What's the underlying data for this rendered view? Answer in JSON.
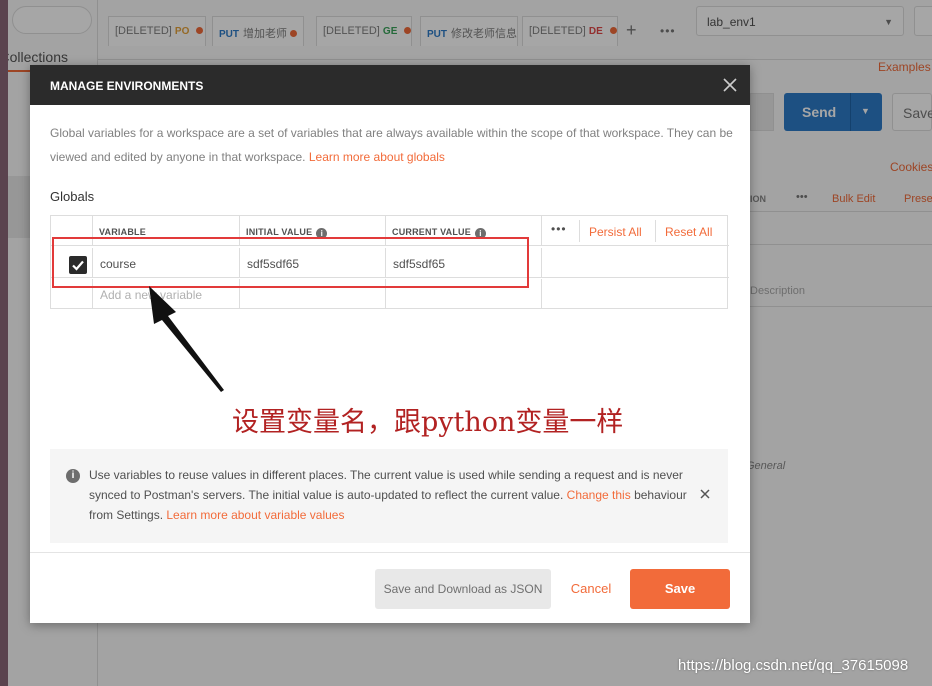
{
  "background": {
    "sidebar_tab": "Collections",
    "tabs": [
      {
        "method": "",
        "label": "[DELETED]",
        "suffix": "PO"
      },
      {
        "method": "PUT",
        "label": "增加老师",
        "suffix": ""
      },
      {
        "method": "",
        "label": "[DELETED]",
        "suffix": "GE"
      },
      {
        "method": "PUT",
        "label": "修改老师信息",
        "suffix": ""
      },
      {
        "method": "",
        "label": "[DELETED]",
        "suffix": "DE"
      }
    ],
    "env_name": "lab_env1",
    "examples_link": "Examples",
    "send_label": "Send",
    "save_label": "Save",
    "cookies_link": "Cookies",
    "params_header_suffix": "ION",
    "bulk_edit": "Bulk Edit",
    "presets": "Presets",
    "description_placeholder": "Description",
    "general_text": "General"
  },
  "modal": {
    "title": "MANAGE ENVIRONMENTS",
    "intro_text": "Global variables for a workspace are a set of variables that are always available within the scope of that workspace. They can be viewed and edited by anyone in that workspace.",
    "intro_link": "Learn more about globals",
    "section_title": "Globals",
    "table": {
      "col_variable": "VARIABLE",
      "col_initial": "INITIAL VALUE",
      "col_current": "CURRENT VALUE",
      "more": "•••",
      "persist_all": "Persist All",
      "reset_all": "Reset All",
      "rows": [
        {
          "checked": true,
          "variable": "course",
          "initial": "sdf5sdf65",
          "current": "sdf5sdf65"
        }
      ],
      "add_placeholder": "Add a new variable"
    },
    "notice": {
      "text": "Use variables to reuse values in different places. The current value is used while sending a request and is never synced to Postman's servers. The initial value is auto-updated to reflect the current value.",
      "link_change": "Change this",
      "text_after": "behaviour from Settings.",
      "link_learn": "Learn more about variable values"
    },
    "buttons": {
      "save_download": "Save and Download as JSON",
      "cancel": "Cancel",
      "save": "Save"
    }
  },
  "annotation": {
    "text": "设置变量名，跟python变量一样",
    "color": "#b22222",
    "box_color": "#e23a3a"
  },
  "watermark": "https://blog.csdn.net/qq_37615098",
  "colors": {
    "accent": "#f26b3a",
    "send": "#2d7bc8",
    "header": "#2b2b2b"
  }
}
